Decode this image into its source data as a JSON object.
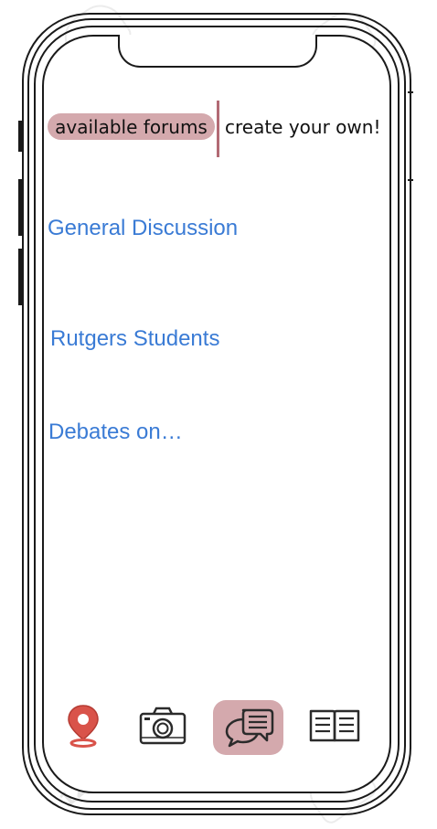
{
  "tabs": {
    "available_label": "available forums",
    "create_label": "create your own!"
  },
  "forums": [
    {
      "label": "General Discussion"
    },
    {
      "label": "Rutgers Students"
    },
    {
      "label": "Debates on…"
    }
  ],
  "nav": {
    "items": [
      {
        "icon": "location-pin-icon",
        "active": false
      },
      {
        "icon": "camera-icon",
        "active": false
      },
      {
        "icon": "chat-bubbles-icon",
        "active": true
      },
      {
        "icon": "open-book-icon",
        "active": false
      }
    ]
  },
  "colors": {
    "accent_pink": "#d4a9ad",
    "divider": "#b26a74",
    "link_blue": "#3a7bd5",
    "pin_red": "#d9534a"
  }
}
